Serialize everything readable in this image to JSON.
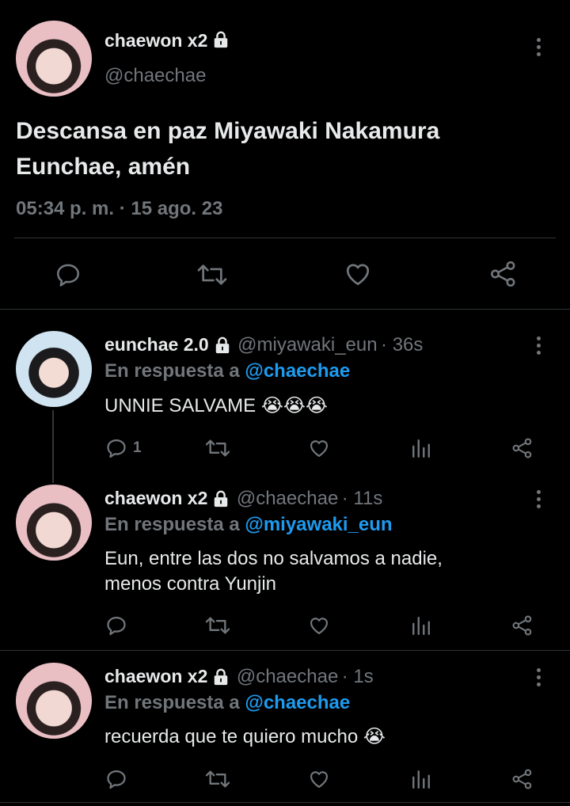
{
  "main_tweet": {
    "name": "chaewon x2",
    "handle": "@chaechae",
    "text": "Descansa en paz Miyawaki Nakamura Eunchae, amén",
    "timestamp": "05:34 p. m. · 15 ago. 23"
  },
  "replies": [
    {
      "name": "eunchae 2.0",
      "handle": "@miyawaki_eun",
      "time": "· 36s",
      "reply_prefix": "En respuesta a",
      "reply_to": "@chaechae",
      "text": "UNNIE SALVAME 😭😭😭",
      "reply_count": "1"
    },
    {
      "name": "chaewon x2",
      "handle": "@chaechae",
      "time": "· 11s",
      "reply_prefix": "En respuesta a",
      "reply_to": "@miyawaki_eun",
      "text_line1": "Eun, entre las dos no salvamos a nadie,",
      "text_line2": "menos contra Yunjin"
    },
    {
      "name": "chaewon x2",
      "handle": "@chaechae",
      "time": "· 1s",
      "reply_prefix": "En respuesta a",
      "reply_to": "@chaechae",
      "text": "recuerda que te quiero mucho 😭"
    }
  ],
  "colors": {
    "background": "#000000",
    "text": "#e7e9ea",
    "muted": "#71767b",
    "accent": "#1d9bf0",
    "divider": "#2f3336"
  },
  "icons": [
    "lock-icon",
    "more-icon",
    "reply-icon",
    "retweet-icon",
    "like-icon",
    "views-icon",
    "share-icon"
  ]
}
